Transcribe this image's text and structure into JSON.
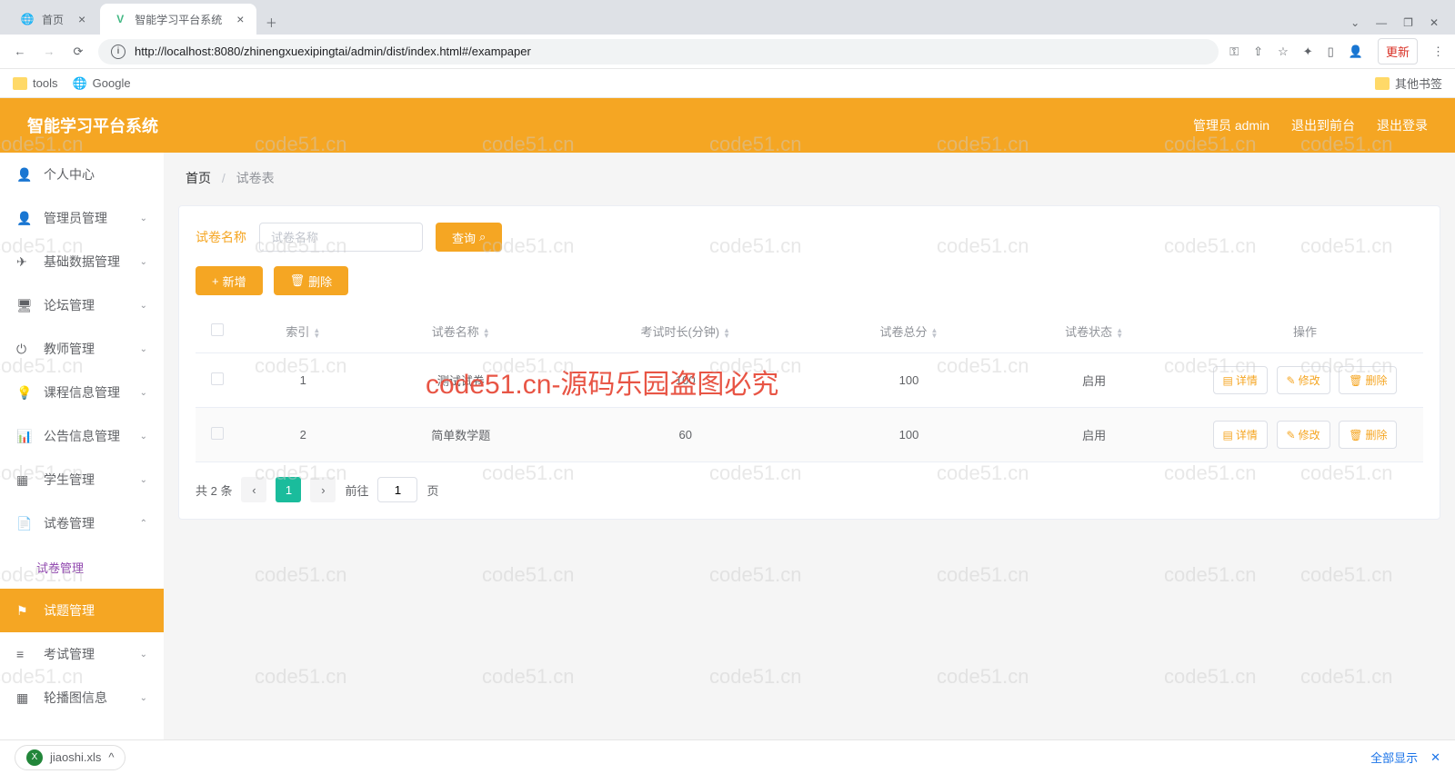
{
  "browser": {
    "tabs": [
      {
        "title": "首页",
        "favicon": "globe"
      },
      {
        "title": "智能学习平台系统",
        "favicon": "vue"
      }
    ],
    "url": "http://localhost:8080/zhinengxuexipingtai/admin/dist/index.html#/exampaper",
    "update_btn": "更新",
    "bookmarks": {
      "tools": "tools",
      "google": "Google",
      "other": "其他书签"
    }
  },
  "header": {
    "title": "智能学习平台系统",
    "user": "管理员 admin",
    "logout_front": "退出到前台",
    "logout": "退出登录"
  },
  "sidebar": [
    {
      "icon": "user",
      "label": "个人中心",
      "type": "item"
    },
    {
      "icon": "user",
      "label": "管理员管理",
      "type": "expand"
    },
    {
      "icon": "send",
      "label": "基础数据管理",
      "type": "expand"
    },
    {
      "icon": "monitor",
      "label": "论坛管理",
      "type": "expand"
    },
    {
      "icon": "power",
      "label": "教师管理",
      "type": "expand"
    },
    {
      "icon": "bulb",
      "label": "课程信息管理",
      "type": "expand"
    },
    {
      "icon": "chart",
      "label": "公告信息管理",
      "type": "expand"
    },
    {
      "icon": "grid",
      "label": "学生管理",
      "type": "expand"
    },
    {
      "icon": "doc",
      "label": "试卷管理",
      "type": "expand-open"
    },
    {
      "label": "试卷管理",
      "type": "sub-active"
    },
    {
      "icon": "flag",
      "label": "试题管理",
      "type": "highlight"
    },
    {
      "icon": "list",
      "label": "考试管理",
      "type": "expand"
    },
    {
      "icon": "grid",
      "label": "轮播图信息",
      "type": "expand"
    }
  ],
  "breadcrumb": {
    "home": "首页",
    "current": "试卷表"
  },
  "search": {
    "label": "试卷名称",
    "placeholder": "试卷名称",
    "query_btn": "查询"
  },
  "action_buttons": {
    "add": "新增",
    "delete": "删除"
  },
  "table": {
    "columns": [
      "",
      "索引",
      "试卷名称",
      "考试时长(分钟)",
      "试卷总分",
      "试卷状态",
      "操作"
    ],
    "rows": [
      {
        "index": "1",
        "name": "测试试卷",
        "duration": "100",
        "score": "100",
        "status": "启用"
      },
      {
        "index": "2",
        "name": "简单数学题",
        "duration": "60",
        "score": "100",
        "status": "启用"
      }
    ],
    "actions": {
      "detail": "详情",
      "edit": "修改",
      "delete": "删除"
    }
  },
  "pagination": {
    "total": "共 2 条",
    "goto": "前往",
    "page": "1",
    "page_suffix": "页"
  },
  "download": {
    "file": "jiaoshi.xls",
    "show_all": "全部显示"
  },
  "watermark": {
    "text": "code51.cn",
    "red": "code51.cn-源码乐园盗图必究"
  }
}
